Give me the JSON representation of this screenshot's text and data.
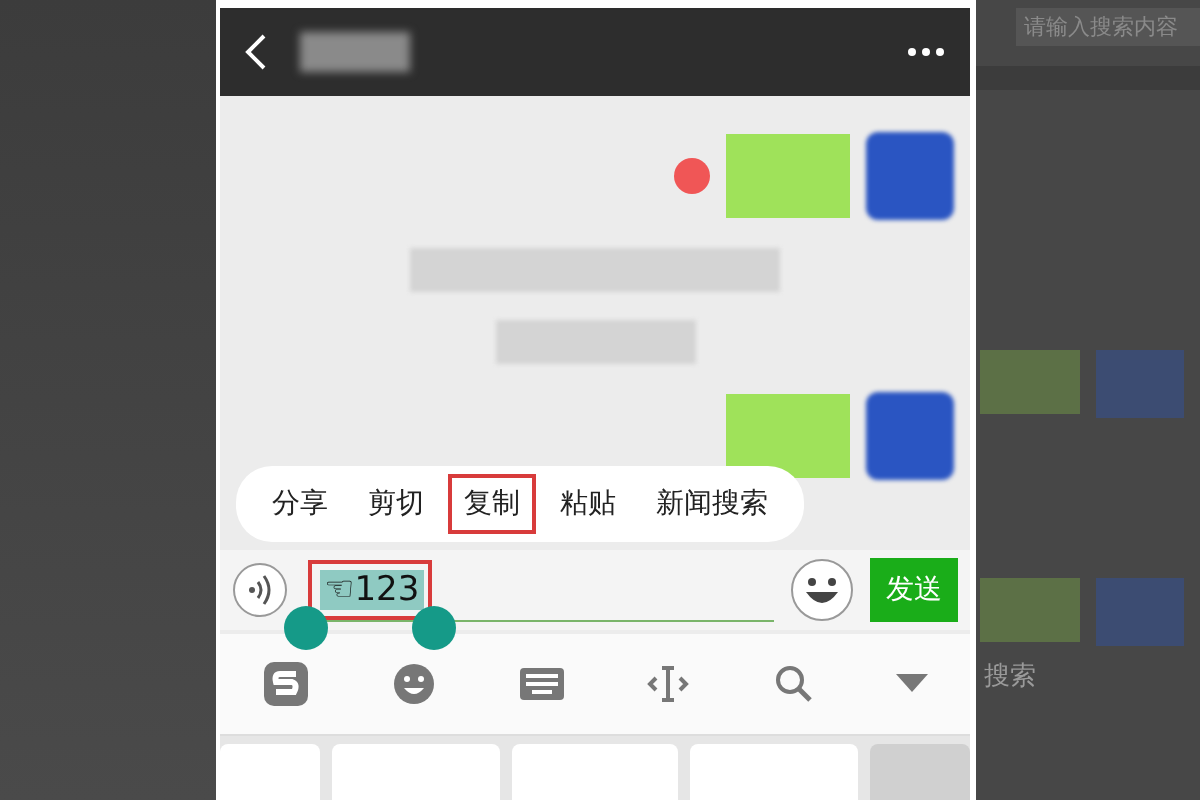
{
  "background": {
    "search": {
      "placeholder": "请输入搜索内容"
    },
    "label": "搜索"
  },
  "messages": [
    {
      "kind": "outgoing",
      "failed": true
    },
    {
      "kind": "system"
    },
    {
      "kind": "system"
    },
    {
      "kind": "outgoing",
      "failed": false
    }
  ],
  "context_menu": [
    {
      "label": "分享",
      "highlighted": false
    },
    {
      "label": "剪切",
      "highlighted": false
    },
    {
      "label": "复制",
      "highlighted": true
    },
    {
      "label": "粘贴",
      "highlighted": false
    },
    {
      "label": "新闻搜索",
      "highlighted": false
    }
  ],
  "input": {
    "value": "☜123",
    "text_selected": true,
    "highlighted": true
  },
  "send_button": "发送"
}
